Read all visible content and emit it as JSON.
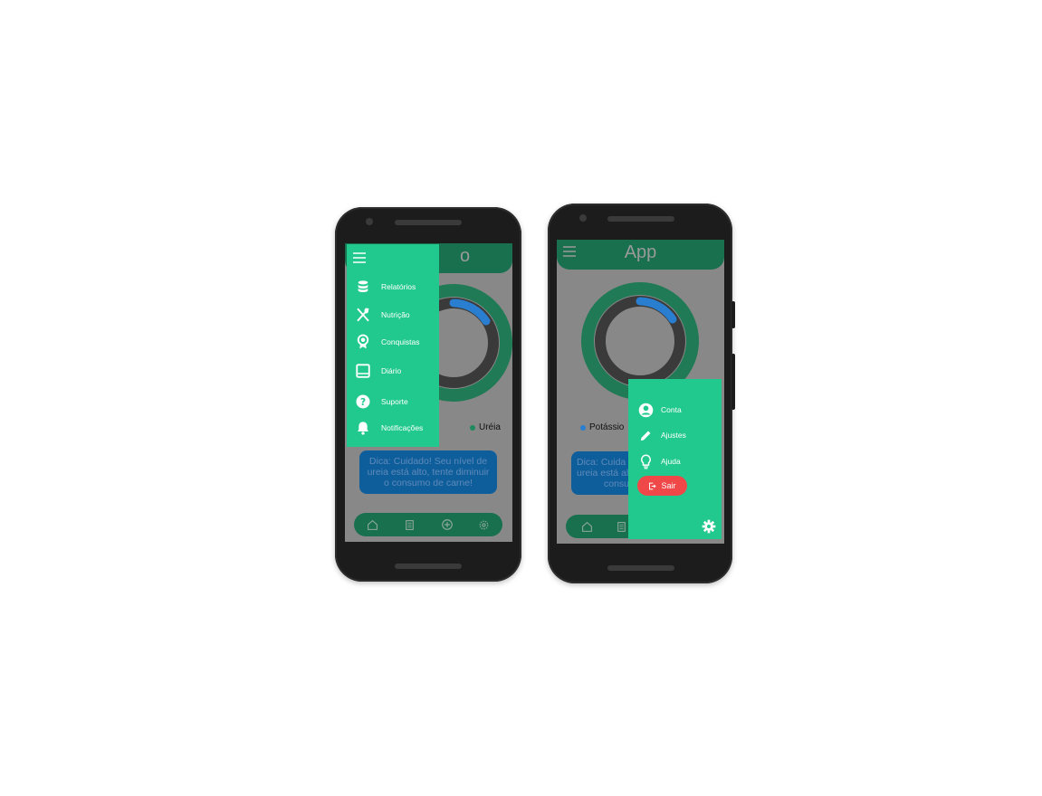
{
  "colors": {
    "accent": "#22c98f",
    "header": "#18704f",
    "overlay": "#888888",
    "chart_blue": "#2a7ed0",
    "tip_bg": "#0f5e9c",
    "logout": "#f04848"
  },
  "phone_left": {
    "drawer": {
      "menu_icon": "hamburger-icon",
      "items": [
        {
          "icon": "database-icon",
          "label": "Relatórios"
        },
        {
          "icon": "utensils-icon",
          "label": "Nutrição"
        },
        {
          "icon": "award-icon",
          "label": "Conquistas"
        },
        {
          "icon": "book-icon",
          "label": "Diário"
        },
        {
          "icon": "help-icon",
          "label": "Suporte"
        },
        {
          "icon": "bell-icon",
          "label": "Notificações"
        }
      ]
    },
    "header_title_partial": "o",
    "legend": {
      "label": "Uréia",
      "color": "#1f8a5e"
    },
    "tip": "Dica: Cuidado! Seu nível de ureia está alto, tente diminuir o consumo de carne!",
    "nav": [
      "home-icon",
      "document-icon",
      "add-icon",
      "settings-icon"
    ]
  },
  "phone_right": {
    "header_title": "App",
    "legend": {
      "label": "Potássio",
      "color": "#2a7ed0"
    },
    "tip_partial": [
      "Dica: Cuida",
      "ureia está alt",
      "consu"
    ],
    "settings": {
      "items": [
        {
          "icon": "account-icon",
          "label": "Conta"
        },
        {
          "icon": "pencil-icon",
          "label": "Ajustes"
        },
        {
          "icon": "lightbulb-icon",
          "label": "Ajuda"
        }
      ],
      "logout_label": "Sair",
      "gear_icon": "gear-icon"
    },
    "nav": [
      "home-icon",
      "document-icon"
    ]
  }
}
